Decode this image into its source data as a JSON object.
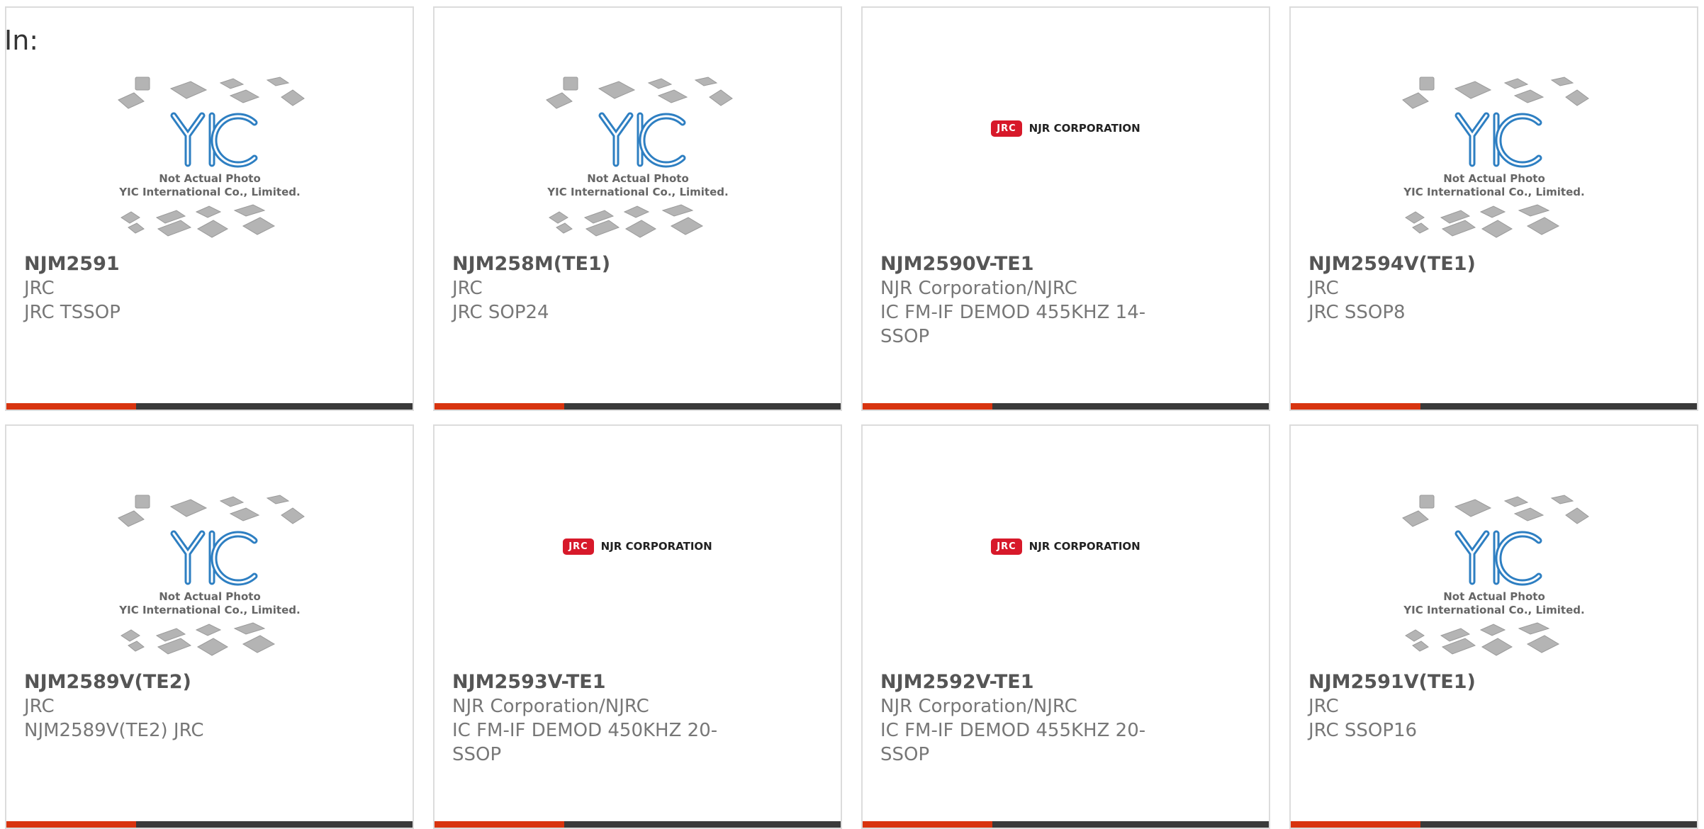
{
  "filter_label": "In:",
  "placeholder": {
    "logo_text": "YIC",
    "line1": "Not Actual Photo",
    "line2": "YIC International Co., Limited."
  },
  "njr_logo": {
    "badge": "JRC",
    "text": "NJR CORPORATION"
  },
  "colors": {
    "accent": "#d8340f",
    "bar": "#3a3a3a",
    "yic_blue": "#1e7fc4",
    "njr_red": "#d7192a"
  },
  "products": [
    {
      "part": "NJM2591",
      "manufacturer": "JRC",
      "description": "JRC TSSOP",
      "image": "yic-placeholder"
    },
    {
      "part": "NJM258M(TE1)",
      "manufacturer": "JRC",
      "description": "JRC SOP24",
      "image": "yic-placeholder"
    },
    {
      "part": "NJM2590V-TE1",
      "manufacturer": "NJR Corporation/NJRC",
      "description": "IC FM-IF DEMOD 455KHZ 14-SSOP",
      "image": "njr-logo"
    },
    {
      "part": "NJM2594V(TE1)",
      "manufacturer": "JRC",
      "description": "JRC SSOP8",
      "image": "yic-placeholder"
    },
    {
      "part": "NJM2589V(TE2)",
      "manufacturer": "JRC",
      "description": "NJM2589V(TE2) JRC",
      "image": "yic-placeholder"
    },
    {
      "part": "NJM2593V-TE1",
      "manufacturer": "NJR Corporation/NJRC",
      "description": "IC FM-IF DEMOD 450KHZ 20-SSOP",
      "image": "njr-logo"
    },
    {
      "part": "NJM2592V-TE1",
      "manufacturer": "NJR Corporation/NJRC",
      "description": "IC FM-IF DEMOD 455KHZ 20-SSOP",
      "image": "njr-logo"
    },
    {
      "part": "NJM2591V(TE1)",
      "manufacturer": "JRC",
      "description": "JRC SSOP16",
      "image": "yic-placeholder"
    }
  ]
}
